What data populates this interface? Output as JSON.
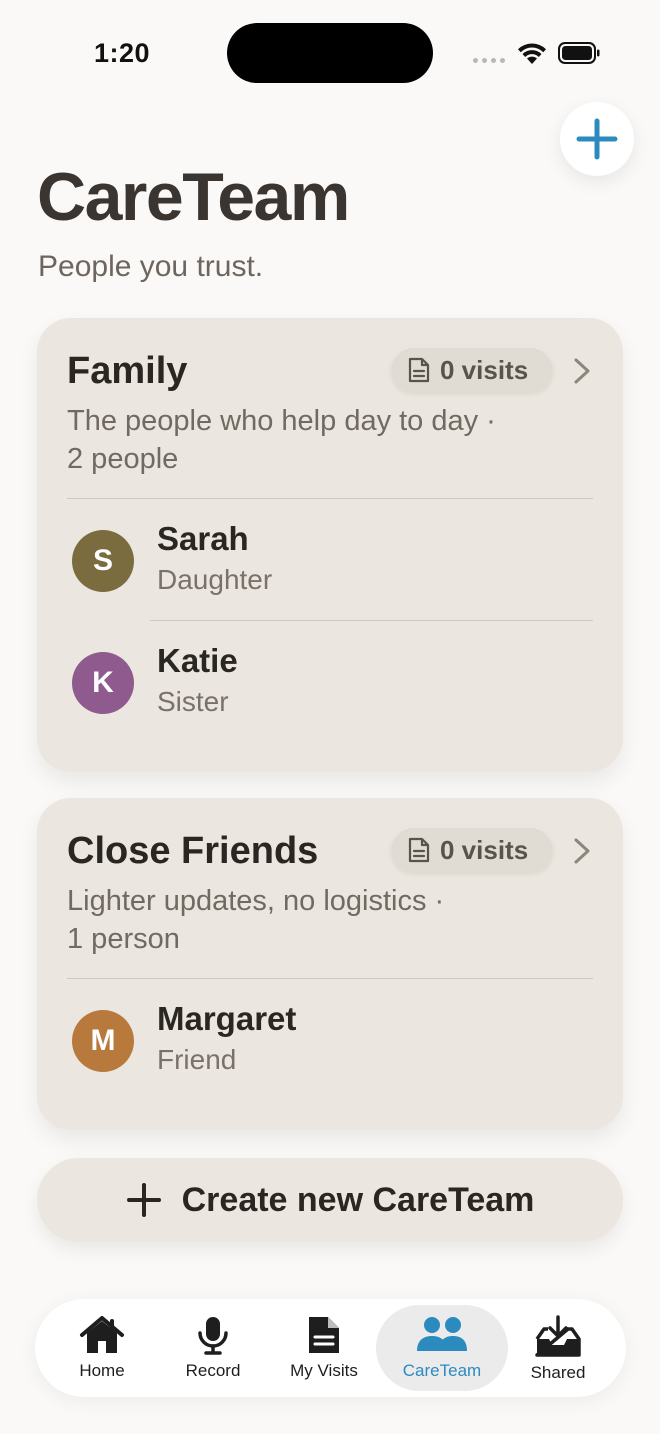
{
  "status": {
    "time": "1:20"
  },
  "header": {
    "title": "CareTeam",
    "subtitle": "People you trust."
  },
  "groups": [
    {
      "name": "Family",
      "visits": "0 visits",
      "description_line1": "The people who help day to day ·",
      "description_line2": "2 people",
      "members": [
        {
          "initial": "S",
          "name": "Sarah",
          "role": "Daughter",
          "color": "#7a6c3f"
        },
        {
          "initial": "K",
          "name": "Katie",
          "role": "Sister",
          "color": "#8f5a8e"
        }
      ]
    },
    {
      "name": "Close Friends",
      "visits": "0 visits",
      "description_line1": "Lighter updates, no logistics ·",
      "description_line2": "1 person",
      "members": [
        {
          "initial": "M",
          "name": "Margaret",
          "role": "Friend",
          "color": "#b87a3c"
        }
      ]
    }
  ],
  "create_button": {
    "label": "Create new CareTeam"
  },
  "tabs": [
    {
      "label": "Home",
      "icon": "home-icon"
    },
    {
      "label": "Record",
      "icon": "microphone-icon"
    },
    {
      "label": "My Visits",
      "icon": "document-icon"
    },
    {
      "label": "CareTeam",
      "icon": "people-icon",
      "active": true
    },
    {
      "label": "Shared",
      "icon": "inbox-icon"
    }
  ],
  "colors": {
    "accent": "#2b8bbf",
    "card": "#ebe6df",
    "background": "#faf9f7"
  }
}
